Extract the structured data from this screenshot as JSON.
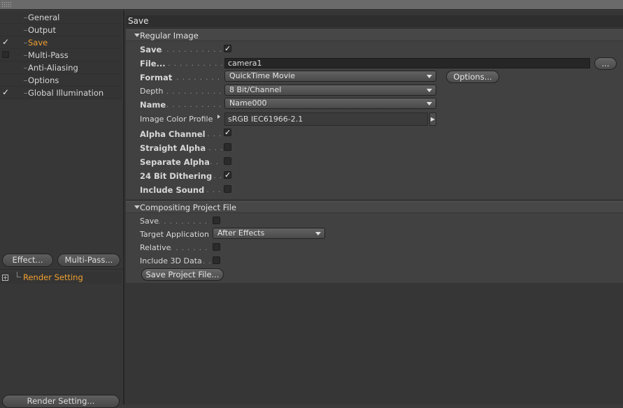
{
  "sidebar": {
    "items": [
      {
        "label": "General",
        "checked": null
      },
      {
        "label": "Output",
        "checked": null
      },
      {
        "label": "Save",
        "checked": true,
        "active": true
      },
      {
        "label": "Multi-Pass",
        "checked": false
      },
      {
        "label": "Anti-Aliasing",
        "checked": null
      },
      {
        "label": "Options",
        "checked": null
      },
      {
        "label": "Global Illumination",
        "checked": true
      }
    ],
    "effect_button": "Effect...",
    "multipass_button": "Multi-Pass...",
    "render_setting_label": "Render Setting",
    "render_setting_button": "Render Setting..."
  },
  "panel": {
    "title": "Save",
    "regular_image": {
      "header": "Regular Image",
      "save_label": "Save",
      "save_checked": true,
      "file_label": "File...",
      "file_value": "camera1",
      "file_browse": "...",
      "format_label": "Format",
      "format_value": "QuickTime Movie",
      "options_button": "Options...",
      "depth_label": "Depth",
      "depth_value": "8 Bit/Channel",
      "name_label": "Name",
      "name_value": "Name000",
      "profile_label": "Image Color Profile",
      "profile_value": "sRGB IEC61966-2.1",
      "alpha_label": "Alpha Channel",
      "alpha_checked": true,
      "straight_label": "Straight Alpha",
      "straight_checked": false,
      "separate_label": "Separate Alpha",
      "separate_checked": false,
      "dither_label": "24 Bit Dithering",
      "dither_checked": true,
      "sound_label": "Include Sound",
      "sound_checked": false
    },
    "compositing": {
      "header": "Compositing Project File",
      "save_label": "Save",
      "save_checked": false,
      "target_label": "Target Application",
      "target_value": "After Effects",
      "relative_label": "Relative",
      "relative_checked": false,
      "include3d_label": "Include 3D Data",
      "include3d_checked": false,
      "save_project_button": "Save Project File..."
    }
  },
  "dot_leader": ". . . . . . . . . . . . . . . . . . . . . . . . . . . . . . . . . . . . . . . .",
  "check_glyph": "✓"
}
